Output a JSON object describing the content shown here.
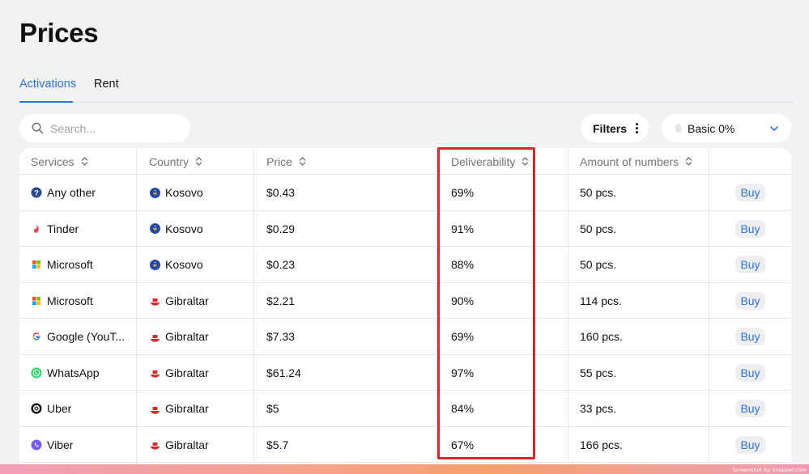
{
  "page": {
    "title": "Prices"
  },
  "tabs": [
    {
      "label": "Activations",
      "active": true
    },
    {
      "label": "Rent",
      "active": false
    }
  ],
  "search": {
    "placeholder": "Search...",
    "icon": "search-icon"
  },
  "filters": {
    "label": "Filters",
    "icon": "kebab-icon"
  },
  "plan": {
    "label": "Basic 0%",
    "icon": "chevron-down-icon"
  },
  "table": {
    "columns": [
      "Services",
      "Country",
      "Price",
      "Deliverability",
      "Amount of numbers",
      ""
    ],
    "buy_label": "Buy",
    "rows": [
      {
        "service": "Any other",
        "service_icon": "question-icon",
        "country": "Kosovo",
        "country_icon": "kosovo-flag-icon",
        "price": "$0.43",
        "deliverability": "69%",
        "amount": "50 pcs."
      },
      {
        "service": "Tinder",
        "service_icon": "tinder-icon",
        "country": "Kosovo",
        "country_icon": "kosovo-flag-icon",
        "price": "$0.29",
        "deliverability": "91%",
        "amount": "50 pcs."
      },
      {
        "service": "Microsoft",
        "service_icon": "microsoft-icon",
        "country": "Kosovo",
        "country_icon": "kosovo-flag-icon",
        "price": "$0.23",
        "deliverability": "88%",
        "amount": "50 pcs."
      },
      {
        "service": "Microsoft",
        "service_icon": "microsoft-icon",
        "country": "Gibraltar",
        "country_icon": "gibraltar-flag-icon",
        "price": "$2.21",
        "deliverability": "90%",
        "amount": "114 pcs."
      },
      {
        "service": "Google (YouT...",
        "service_icon": "google-icon",
        "country": "Gibraltar",
        "country_icon": "gibraltar-flag-icon",
        "price": "$7.33",
        "deliverability": "69%",
        "amount": "160 pcs."
      },
      {
        "service": "WhatsApp",
        "service_icon": "whatsapp-icon",
        "country": "Gibraltar",
        "country_icon": "gibraltar-flag-icon",
        "price": "$61.24",
        "deliverability": "97%",
        "amount": "55 pcs."
      },
      {
        "service": "Uber",
        "service_icon": "uber-icon",
        "country": "Gibraltar",
        "country_icon": "gibraltar-flag-icon",
        "price": "$5",
        "deliverability": "84%",
        "amount": "33 pcs."
      },
      {
        "service": "Viber",
        "service_icon": "viber-icon",
        "country": "Gibraltar",
        "country_icon": "gibraltar-flag-icon",
        "price": "$5.7",
        "deliverability": "67%",
        "amount": "166 pcs."
      }
    ]
  },
  "colors": {
    "accent": "#2f72d9",
    "highlight": "#d62a2a",
    "background": "#f1f2f4"
  },
  "footer": {
    "credit": "Screenshot by Xnapper.com"
  }
}
